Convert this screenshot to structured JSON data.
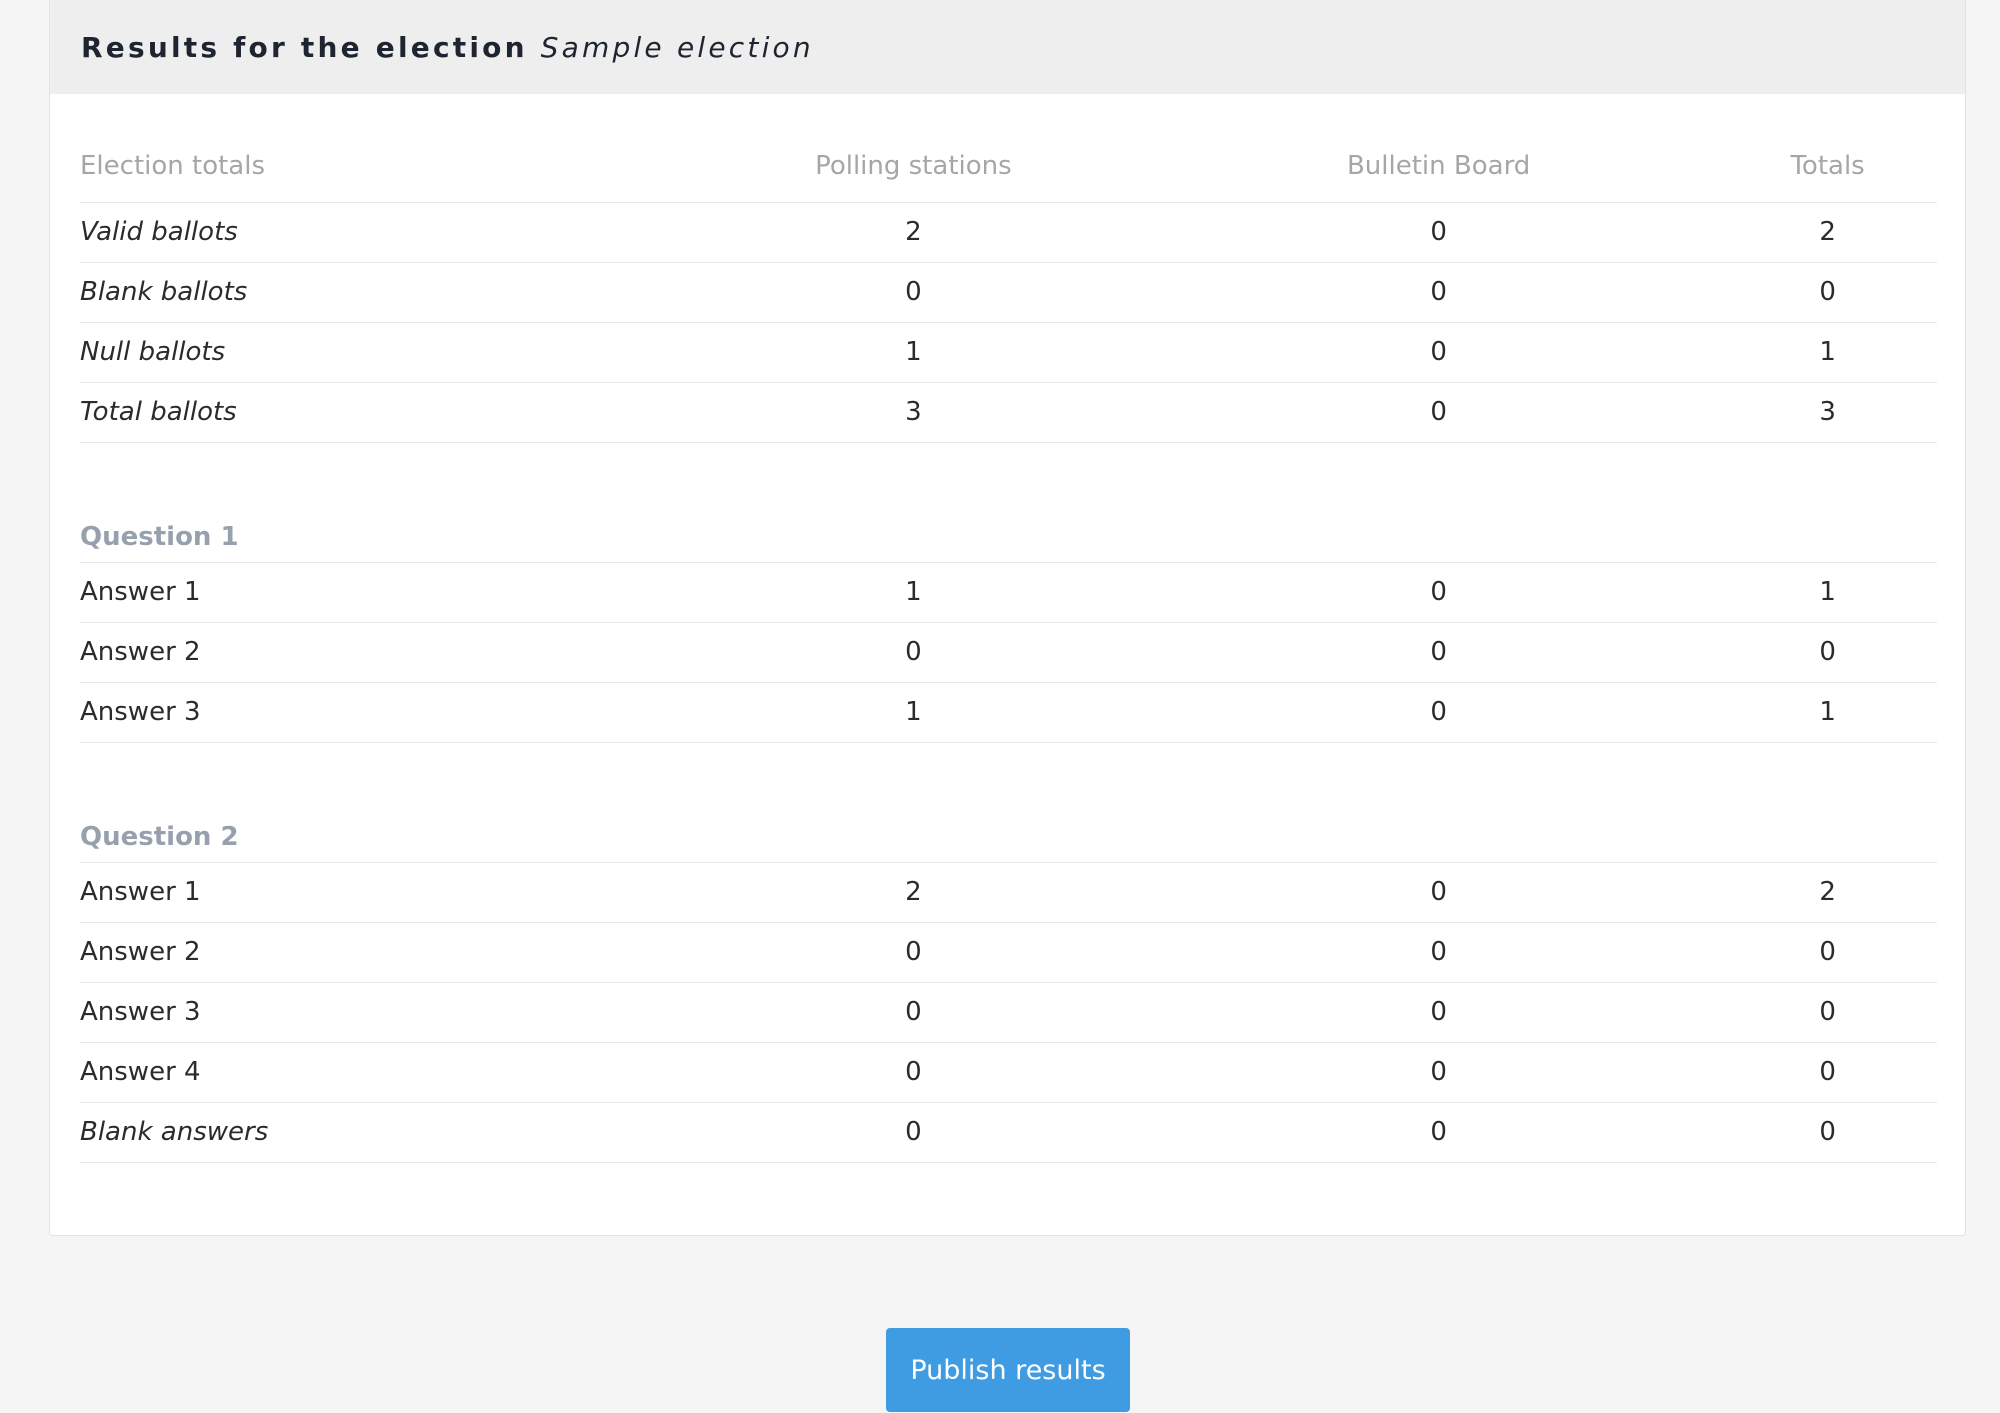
{
  "header": {
    "prefix": "Results for the election",
    "election_name": "Sample election"
  },
  "table": {
    "columns": [
      "Election totals",
      "Polling stations",
      "Bulletin Board",
      "Totals"
    ],
    "totals_rows": [
      {
        "label": "Valid ballots",
        "values": [
          "2",
          "0",
          "2"
        ]
      },
      {
        "label": "Blank ballots",
        "values": [
          "0",
          "0",
          "0"
        ]
      },
      {
        "label": "Null ballots",
        "values": [
          "1",
          "0",
          "1"
        ]
      },
      {
        "label": "Total ballots",
        "values": [
          "3",
          "0",
          "3"
        ]
      }
    ],
    "questions": [
      {
        "title": "Question 1",
        "answers": [
          {
            "label": "Answer 1",
            "values": [
              "1",
              "0",
              "1"
            ]
          },
          {
            "label": "Answer 2",
            "values": [
              "0",
              "0",
              "0"
            ]
          },
          {
            "label": "Answer 3",
            "values": [
              "1",
              "0",
              "1"
            ]
          }
        ]
      },
      {
        "title": "Question 2",
        "answers": [
          {
            "label": "Answer 1",
            "values": [
              "2",
              "0",
              "2"
            ]
          },
          {
            "label": "Answer 2",
            "values": [
              "0",
              "0",
              "0"
            ]
          },
          {
            "label": "Answer 3",
            "values": [
              "0",
              "0",
              "0"
            ]
          },
          {
            "label": "Answer 4",
            "values": [
              "0",
              "0",
              "0"
            ]
          },
          {
            "label": "Blank answers",
            "values": [
              "0",
              "0",
              "0"
            ],
            "italic": true
          }
        ]
      }
    ]
  },
  "actions": {
    "publish_label": "Publish results"
  },
  "colors": {
    "page_background": "#f5f5f5",
    "header_background": "#eeeeee",
    "button_background": "#3f9be2",
    "muted_text": "#a6a6a6",
    "question_text": "#97a1ad"
  }
}
